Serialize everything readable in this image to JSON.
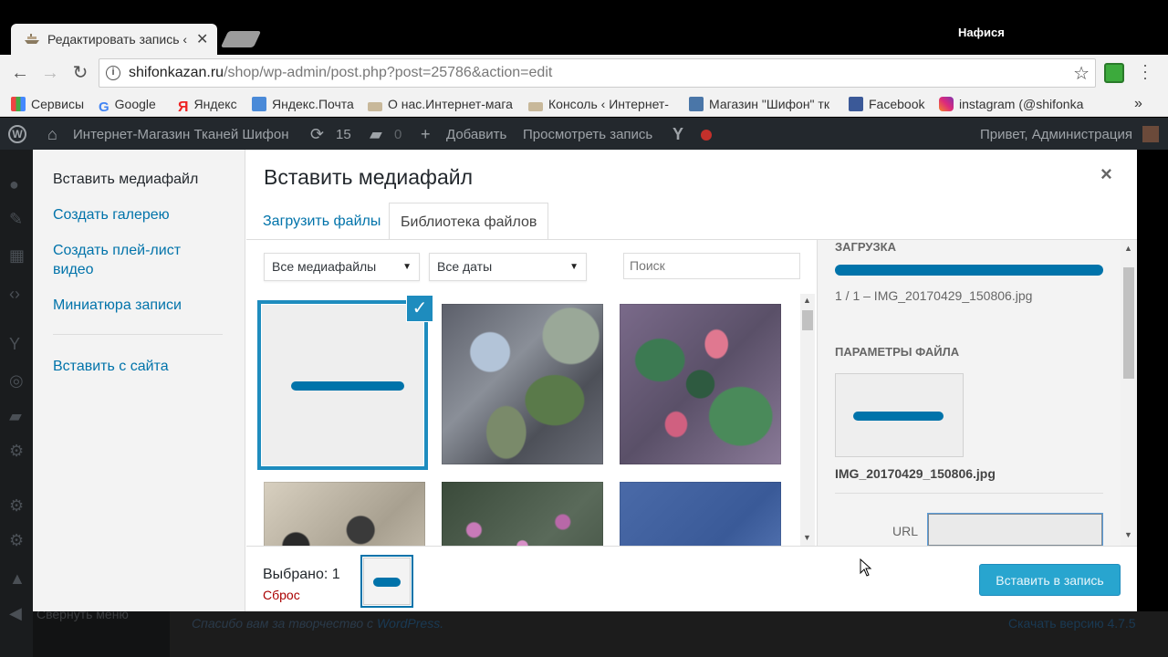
{
  "browser": {
    "tab_title": "Редактировать запись ‹",
    "user_name": "Нафися",
    "url_host": "shifonkazan.ru",
    "url_path": "/shop/wp-admin/post.php?post=25786&action=edit",
    "bookmarks": [
      {
        "label": "Сервисы",
        "icon": "apps-icon"
      },
      {
        "label": "Google",
        "icon": "google-icon"
      },
      {
        "label": "Яндекс",
        "icon": "yandex-icon"
      },
      {
        "label": "Яндекс.Почта",
        "icon": "mail-icon"
      },
      {
        "label": "О нас.Интернет-мага",
        "icon": "ship-icon"
      },
      {
        "label": "Консоль ‹ Интернет-",
        "icon": "ship-icon"
      },
      {
        "label": "Магазин \"Шифон\" тк",
        "icon": "vk-icon"
      },
      {
        "label": "Facebook",
        "icon": "facebook-icon"
      },
      {
        "label": "instagram (@shifonka",
        "icon": "instagram-icon"
      }
    ],
    "bookmarks_overflow": "»"
  },
  "adminbar": {
    "site_name": "Интернет-Магазин Тканей Шифон",
    "updates_count": "15",
    "comments_count": "0",
    "add_new": "Добавить",
    "view_post": "Просмотреть запись",
    "greeting": "Привет, Администрация"
  },
  "footer": {
    "collapse_menu": "Свернуть меню",
    "thanks_prefix": "Спасибо вам за творчество с ",
    "thanks_link": "WordPress.",
    "version_link": "Скачать версию 4.7.5"
  },
  "modal": {
    "title": "Вставить медиафайл",
    "close_glyph": "×",
    "menu": [
      "Вставить медиафайл",
      "Создать галерею",
      "Создать плей-лист видео",
      "Миниатюра записи",
      "Вставить с сайта"
    ],
    "tabs": [
      "Загрузить файлы",
      "Библиотека файлов"
    ],
    "filter_type": "Все медиафайлы",
    "filter_date": "Все даты",
    "search_placeholder": "Поиск",
    "sidebar": {
      "upload_heading": "Загрузка",
      "upload_status": "1 / 1 – IMG_20170429_150806.jpg",
      "upload_progress": 1.0,
      "details_heading": "Параметры файла",
      "filename": "IMG_20170429_150806.jpg",
      "url_label": "URL",
      "url_value": ""
    },
    "selection": {
      "count_label": "Выбрано: 1",
      "reset_label": "Сброс"
    },
    "insert_button": "Вставить в запись"
  },
  "colors": {
    "accent": "#0073aa",
    "adminbar": "#23282d",
    "insert_button": "#28a5cf",
    "reset_link": "#aa0000"
  }
}
